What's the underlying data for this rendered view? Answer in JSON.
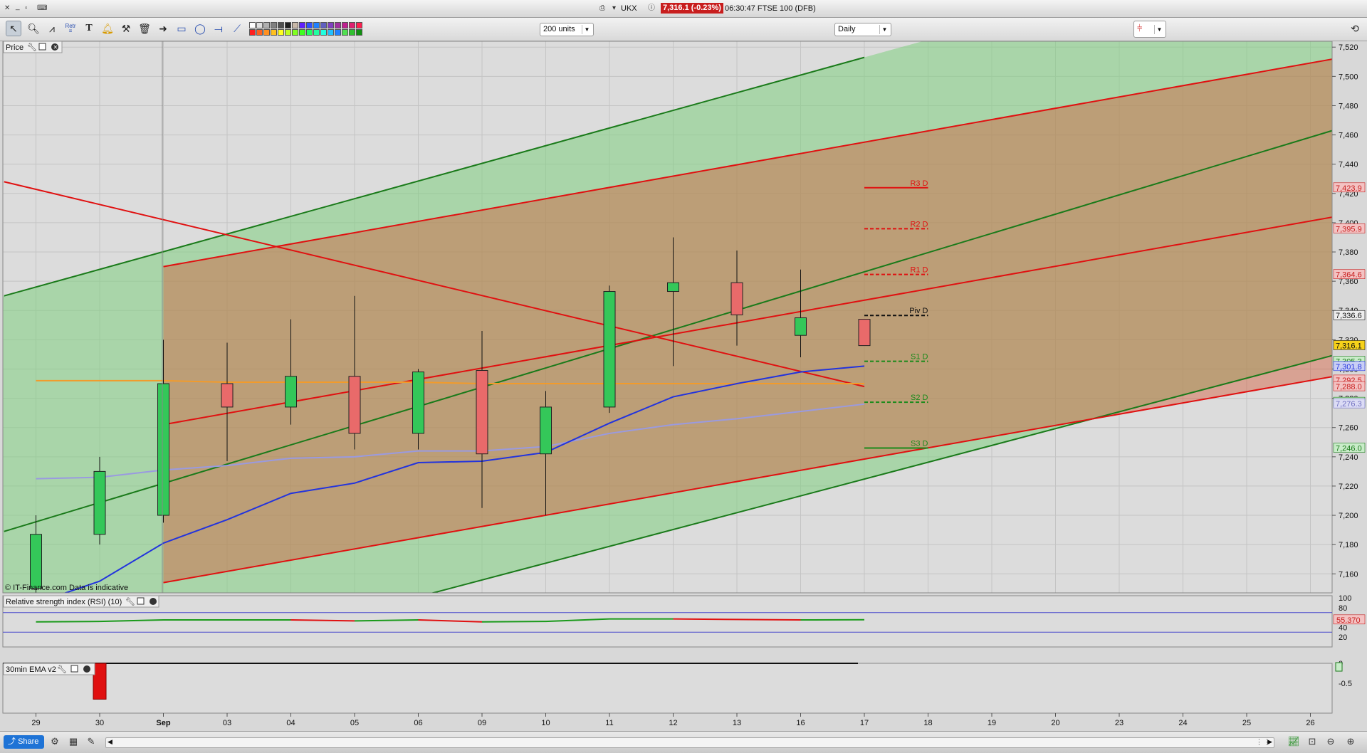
{
  "window": {
    "symbol": "UKX",
    "last_quote": "7,316.1 (-0.23%)",
    "quote_time_name": "06:30:47 FTSE 100 (DFB)"
  },
  "toolbar": {
    "units_value": "200 units",
    "interval_value": "Daily",
    "fib_label": "Retr"
  },
  "footer": {
    "share_label": "Share"
  },
  "colors": {
    "up_candle": "#34c759",
    "down_candle": "#e96a6a",
    "green_channel": "#1a7a1a",
    "red_channel": "#e01010",
    "ema_fast": "#2233dd",
    "ema_slow": "#9a9ae0",
    "ema_long": "#f29b2b",
    "quote_bg": "#c81e1e"
  },
  "chart_data": {
    "type": "candlestick",
    "panel_title": "Price",
    "copyright": "© IT-Finance.com  Data is indicative",
    "x_tick_labels": [
      "29",
      "30",
      "Sep",
      "03",
      "04",
      "05",
      "06",
      "09",
      "10",
      "11",
      "12",
      "13",
      "16",
      "17",
      "18",
      "19",
      "20",
      "23",
      "24",
      "25",
      "26"
    ],
    "y_ticks": [
      7160,
      7180,
      7200,
      7220,
      7240,
      7260,
      7280,
      7300,
      7320,
      7340,
      7360,
      7380,
      7400,
      7420,
      7440,
      7460,
      7480,
      7500,
      7520
    ],
    "ylim": [
      7147,
      7524
    ],
    "candles": [
      {
        "date": "29",
        "open": 7150,
        "high": 7200,
        "low": 7140,
        "close": 7187
      },
      {
        "date": "30",
        "open": 7187,
        "high": 7240,
        "low": 7180,
        "close": 7230
      },
      {
        "date": "Sep",
        "open": 7200,
        "high": 7320,
        "low": 7195,
        "close": 7290
      },
      {
        "date": "03",
        "open": 7290,
        "high": 7318,
        "low": 7237,
        "close": 7274
      },
      {
        "date": "04",
        "open": 7274,
        "high": 7334,
        "low": 7262,
        "close": 7295
      },
      {
        "date": "05",
        "open": 7295,
        "high": 7350,
        "low": 7245,
        "close": 7256
      },
      {
        "date": "06",
        "open": 7256,
        "high": 7300,
        "low": 7245,
        "close": 7298
      },
      {
        "date": "09",
        "open": 7299,
        "high": 7326,
        "low": 7205,
        "close": 7242
      },
      {
        "date": "10",
        "open": 7242,
        "high": 7285,
        "low": 7200,
        "close": 7274
      },
      {
        "date": "11",
        "open": 7274,
        "high": 7357,
        "low": 7270,
        "close": 7353
      },
      {
        "date": "12",
        "open": 7353,
        "high": 7390,
        "low": 7302,
        "close": 7359
      },
      {
        "date": "13",
        "open": 7359,
        "high": 7381,
        "low": 7316,
        "close": 7337
      },
      {
        "date": "16",
        "open": 7323,
        "high": 7368,
        "low": 7308,
        "close": 7335
      },
      {
        "date": "17",
        "open": 7334,
        "high": 7334,
        "low": 7316,
        "close": 7316
      }
    ],
    "ema_fast_values": [
      7140,
      7155,
      7181,
      7197,
      7215,
      7222,
      7236,
      7237,
      7243,
      7263,
      7281,
      7290,
      7298,
      7302
    ],
    "ema_slow_values": [
      7225,
      7226,
      7231,
      7234,
      7239,
      7240,
      7244,
      7244,
      7247,
      7256,
      7262,
      7266,
      7271,
      7276
    ],
    "ema_long_values": [
      7292,
      7292,
      7292,
      7291,
      7291,
      7291,
      7291,
      7290,
      7290,
      7290,
      7290,
      7290,
      7290,
      7290
    ],
    "pivots": [
      {
        "label": "R3 D",
        "value": 7423.9,
        "style": "solid",
        "color": "#e01010"
      },
      {
        "label": "R2 D",
        "value": 7395.9,
        "style": "dashed",
        "color": "#e01010"
      },
      {
        "label": "R1 D",
        "value": 7364.6,
        "style": "dashed",
        "color": "#e01010"
      },
      {
        "label": "Piv D",
        "value": 7336.6,
        "style": "dashed",
        "color": "#111111"
      },
      {
        "label": "S1 D",
        "value": 7305.3,
        "style": "dashed",
        "color": "#1a8a1a"
      },
      {
        "label": "S2 D",
        "value": 7277.3,
        "style": "dashed",
        "color": "#1a8a1a"
      },
      {
        "label": "S3 D",
        "value": 7246.0,
        "style": "solid",
        "color": "#1a8a1a"
      }
    ],
    "price_tags": [
      {
        "value": 7423.9,
        "text": "7,423.9",
        "bg": "#f3c3c3",
        "fg": "#c81e1e"
      },
      {
        "value": 7395.9,
        "text": "7,395.9",
        "bg": "#f3c3c3",
        "fg": "#c81e1e"
      },
      {
        "value": 7364.6,
        "text": "7,364.6",
        "bg": "#f3c3c3",
        "fg": "#c81e1e"
      },
      {
        "value": 7336.6,
        "text": "7,336.6",
        "bg": "#eeeeee",
        "fg": "#111111"
      },
      {
        "value": 7316.1,
        "text": "7,316.1",
        "bg": "#f7d21a",
        "fg": "#111111"
      },
      {
        "value": 7305.3,
        "text": "7,305.3",
        "bg": "#c9ecc9",
        "fg": "#1a7a1a"
      },
      {
        "value": 7301.8,
        "text": "7,301.8",
        "bg": "#c9cff5",
        "fg": "#2233dd"
      },
      {
        "value": 7292.5,
        "text": "7,292.5",
        "bg": "#f3c3c3",
        "fg": "#c81e1e"
      },
      {
        "value": 7288.0,
        "text": "7,288.0",
        "bg": "#f3c3c3",
        "fg": "#c81e1e"
      },
      {
        "value": 7277.3,
        "text": "7,277.3",
        "bg": "#c9ecc9",
        "fg": "#1a7a1a"
      },
      {
        "value": 7276.3,
        "text": "7,276.3",
        "bg": "#dcdcf5",
        "fg": "#7070c0"
      },
      {
        "value": 7246.0,
        "text": "7,246.0",
        "bg": "#c9ecc9",
        "fg": "#1a7a1a"
      }
    ],
    "channels": {
      "green_upper": [
        {
          "x": -0.5,
          "y": 7350
        },
        {
          "x": 13,
          "y": 7513
        }
      ],
      "green_lower": [
        {
          "x": 5.8,
          "y": 7142
        },
        {
          "x": 20.5,
          "y": 7311
        }
      ],
      "green_mid": [
        {
          "x": -0.5,
          "y": 7189
        },
        {
          "x": 20.5,
          "y": 7465
        }
      ],
      "red_upper": [
        {
          "x": 2,
          "y": 7370
        },
        {
          "x": 20.5,
          "y": 7513
        }
      ],
      "red_lower": [
        {
          "x": 2,
          "y": 7154
        },
        {
          "x": 20.5,
          "y": 7296
        }
      ],
      "red_mid": [
        {
          "x": 2,
          "y": 7262
        },
        {
          "x": 20.5,
          "y": 7405
        }
      ],
      "red_down": [
        {
          "x": -0.5,
          "y": 7428
        },
        {
          "x": 13,
          "y": 7288
        }
      ]
    },
    "rsi": {
      "title": "Relative strength index (RSI) (10)",
      "ticks": [
        20,
        40,
        60,
        80,
        100
      ],
      "levels": [
        30,
        70
      ],
      "values": [
        51,
        52,
        55,
        55,
        55,
        53,
        55,
        51,
        52,
        57,
        57,
        56,
        55,
        55.37
      ],
      "last_text": "55.370"
    },
    "ema30": {
      "title": "30min EMA v2",
      "ticks": [
        0,
        -0.5
      ],
      "bar_at": "30",
      "bar_value": -0.9
    }
  }
}
